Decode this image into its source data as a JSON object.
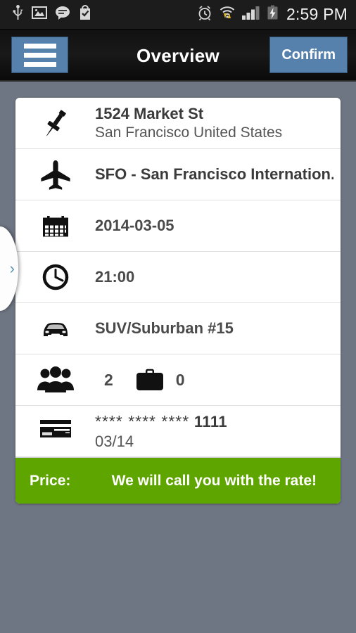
{
  "statusbar": {
    "time": "2:59 PM",
    "left_icons": [
      "usb-icon",
      "image-icon",
      "message-icon",
      "checked-bag-icon"
    ],
    "right_icons": [
      "alarm-icon",
      "wifi-icon",
      "signal-icon",
      "battery-charging-icon"
    ]
  },
  "actionbar": {
    "title": "Overview",
    "menu_icon": "hamburger-menu-icon",
    "confirm_label": "Confirm"
  },
  "drawer": {
    "handle_icon": "chevron-right-icon",
    "handle_glyph": "›"
  },
  "colors": {
    "accent_blue": "#5781ad",
    "price_green": "#5fa500",
    "page_background": "#6f7683",
    "actionbar_background": "#111111",
    "card_background": "#ffffff"
  },
  "card": {
    "rows": [
      {
        "icon": "pushpin-icon",
        "primary": "1524 Market St",
        "secondary": "San Francisco United States"
      },
      {
        "icon": "airplane-icon",
        "primary": "SFO - San Francisco Internation...",
        "secondary": ""
      },
      {
        "icon": "calendar-icon",
        "primary": "2014-03-05",
        "secondary": ""
      },
      {
        "icon": "clock-icon",
        "primary": "21:00",
        "secondary": ""
      },
      {
        "icon": "car-icon",
        "primary": "SUV/Suburban #15",
        "secondary": ""
      }
    ],
    "counts": {
      "passengers_icon": "people-icon",
      "passengers": "2",
      "luggage_icon": "briefcase-icon",
      "luggage": "0"
    },
    "payment": {
      "icon": "credit-card-icon",
      "masked_number_stars": "**** **** ****",
      "masked_number_last4": "1111",
      "expiry": "03/14"
    },
    "price": {
      "label": "Price:",
      "value": "We will call you with the rate!"
    }
  }
}
